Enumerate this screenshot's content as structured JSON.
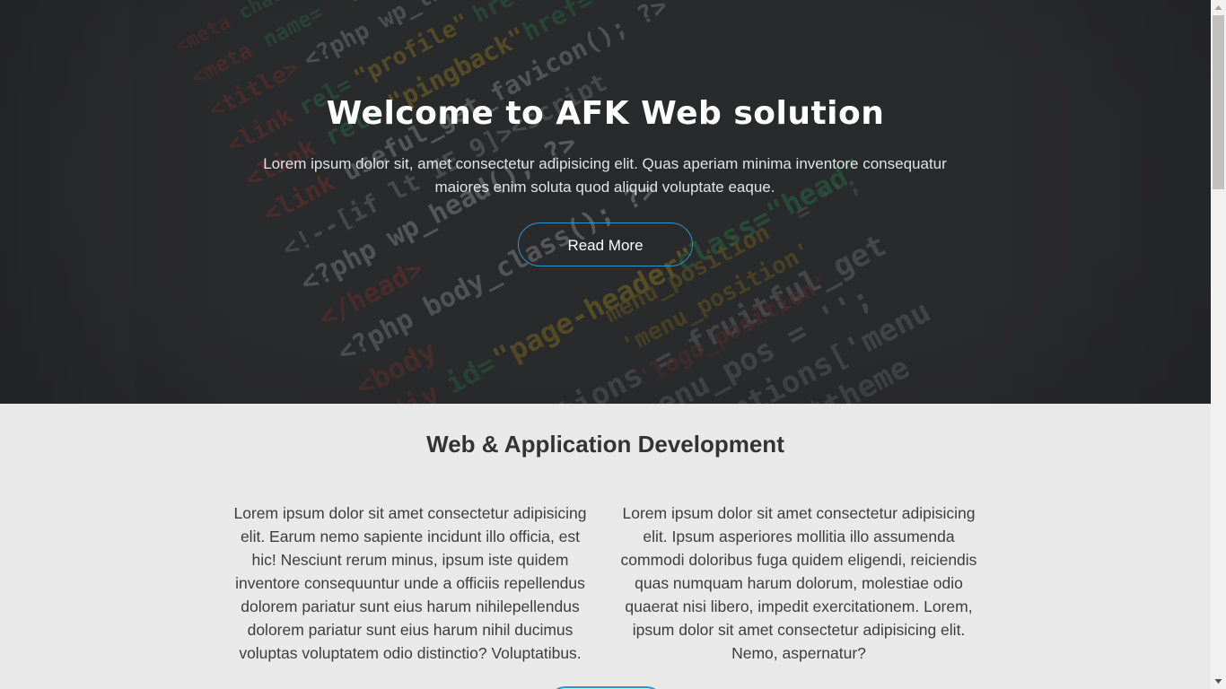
{
  "hero": {
    "title": "Welcome to AFK Web solution",
    "text": "Lorem ipsum dolor sit, amet consectetur adipisicing elit. Quas aperiam minima inventore consequatur maiores enim soluta quod aliquid voluptate eaque.",
    "button_label": "Read More",
    "background_image": "code-editor-photo"
  },
  "section": {
    "title": "Web & Application Development",
    "col_left": "Lorem ipsum dolor sit amet consectetur adipisicing elit. Earum nemo sapiente incidunt illo officia, est hic! Nesciunt rerum minus, ipsum iste quidem inventore consequuntur unde a officiis repellendus dolorem pariatur sunt eius harum nihilepellendus dolorem pariatur sunt eius harum nihil ducimus voluptas voluptatem odio distinctio? Voluptatibus.",
    "col_right": "Lorem ipsum dolor sit amet consectetur adipisicing elit. Ipsum asperiores mollitia illo assumenda commodi doloribus fuga quidem eligendi, reiciendis quas numquam harum dolorum, molestiae odio quaerat nisi libero, impedit exercitationem. Lorem, ipsum dolor sit amet consectetur adipisicing elit. Nemo, aspernatur?"
  },
  "colors": {
    "accent": "#2e94c9",
    "hero_bg": "#2b2c2e",
    "section_bg": "#e9e9e9",
    "heading_text": "#333333",
    "body_text": "#3d3d3d"
  },
  "scrollbar": {
    "up_icon": "triangle-up-icon",
    "down_icon": "triangle-down-icon"
  }
}
